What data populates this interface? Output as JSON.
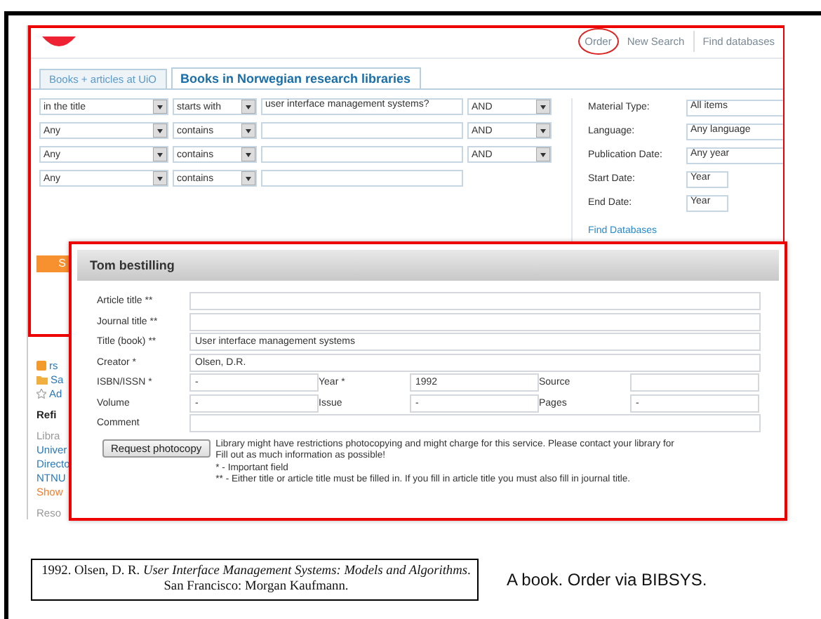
{
  "header_links": [
    {
      "label": "Order",
      "circled": true
    },
    {
      "label": "New Search",
      "circled": false
    },
    {
      "label": "Find databases",
      "circled": false
    }
  ],
  "tabs": [
    {
      "label": "Books + articles at UiO",
      "selected": false
    },
    {
      "label": "Books in Norwegian research libraries",
      "selected": true
    }
  ],
  "search_rows": [
    {
      "field": "in the title",
      "operator": "starts with",
      "value": "user interface management systems?",
      "boolean": "AND"
    },
    {
      "field": "Any",
      "operator": "contains",
      "boolean": "AND"
    },
    {
      "field": "Any",
      "operator": "contains",
      "boolean": "AND"
    },
    {
      "field": "Any",
      "operator": "contains"
    }
  ],
  "filters": [
    {
      "kind": "select",
      "label": "Material Type:",
      "value": "All items"
    },
    {
      "kind": "select",
      "label": "Language:",
      "value": "Any language"
    },
    {
      "kind": "select",
      "label": "Publication Date:",
      "value": "Any year"
    },
    {
      "kind": "input",
      "label": "Start Date:",
      "value": "Year"
    },
    {
      "kind": "input",
      "label": "End Date:",
      "value": "Year"
    }
  ],
  "find_databases_link": "Find Databases",
  "search_button": "S",
  "sidebar": [
    {
      "kind": "rss",
      "text": "rs"
    },
    {
      "kind": "folder",
      "text": "Sa"
    },
    {
      "kind": "star",
      "text": "Ad"
    },
    {
      "kind": "heading",
      "text": "Refi"
    },
    {
      "kind": "section",
      "text": "Libra"
    },
    {
      "kind": "link",
      "text": "Univer"
    },
    {
      "kind": "link",
      "text": "Directo"
    },
    {
      "kind": "link",
      "text": "NTNU"
    },
    {
      "kind": "more",
      "text": "Show"
    },
    {
      "kind": "section",
      "text": "Reso"
    }
  ],
  "dialog": {
    "title": "Tom bestilling",
    "rows": [
      [
        {
          "label": "Article title **"
        }
      ],
      [
        {
          "label": "Journal title **"
        }
      ],
      [
        {
          "label": "Title (book) **",
          "value": "User interface management systems"
        }
      ],
      [
        {
          "label": "Creator *",
          "value": "Olsen, D.R."
        }
      ],
      [
        {
          "label": "ISBN/ISSN *",
          "value": "-"
        },
        {
          "label": "Year *",
          "value": "1992"
        },
        {
          "label": "Source"
        }
      ],
      [
        {
          "label": "Volume",
          "value": "-"
        },
        {
          "label": "Issue",
          "value": "-"
        },
        {
          "label": "Pages",
          "value": "-"
        }
      ],
      [
        {
          "label": "Comment"
        }
      ]
    ],
    "button": "Request photocopy",
    "notes": [
      "Library might have restrictions photocopying and might charge for this service. Please contact your library for",
      "Fill out as much information as possible!",
      "* - Important field",
      "** - Either title or article title must be filled in. If you fill in article title you must also fill in journal title."
    ]
  },
  "caption": {
    "citation": "1992. Olsen, D. R. *User Interface Management Systems: Models and Algorithms*.  San Francisco: Morgan Kaufmann.",
    "note": "A book. Order via BIBSYS."
  }
}
